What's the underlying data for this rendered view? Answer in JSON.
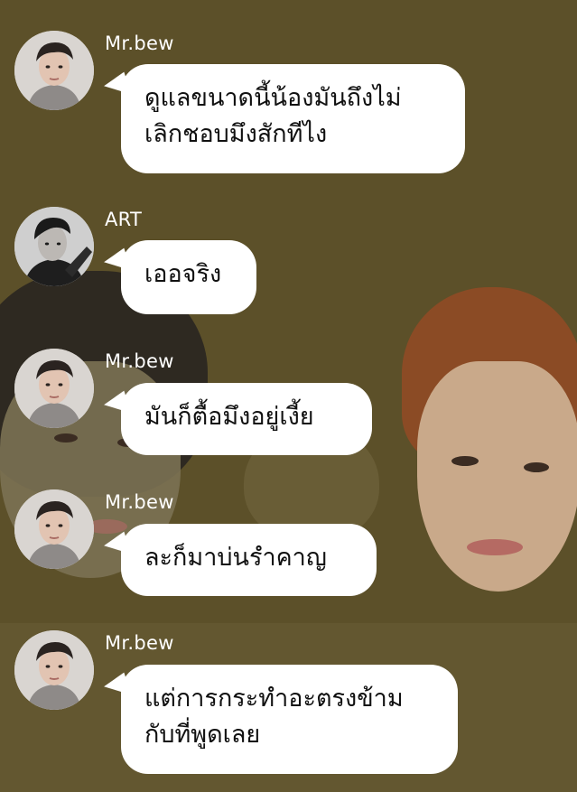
{
  "chat": {
    "messages": [
      {
        "sender": "Mr.bew",
        "avatar_icon": "user-avatar-icon",
        "lines": [
          "ดูแลขนาดนี้น้องมันถึงไม่",
          "เลิกชอบมึงสักทีไง"
        ]
      },
      {
        "sender": "ART",
        "avatar_icon": "user-avatar-icon",
        "lines": [
          "เออจริง"
        ]
      },
      {
        "sender": "Mr.bew",
        "avatar_icon": "user-avatar-icon",
        "lines": [
          "มันก็ตื้อมึงอยู่เงี้ย"
        ]
      },
      {
        "sender": "Mr.bew",
        "avatar_icon": "user-avatar-icon",
        "lines": [
          "ละก็มาบ่นรำคาญ"
        ]
      },
      {
        "sender": "Mr.bew",
        "avatar_icon": "user-avatar-icon",
        "lines": [
          "แต่การกระทำอะตรงข้าม",
          "กับที่พูดเลย"
        ]
      }
    ]
  },
  "colors": {
    "background": "#5c5029",
    "bubble": "#ffffff",
    "sender_text": "#ffffff",
    "message_text": "#111111"
  }
}
